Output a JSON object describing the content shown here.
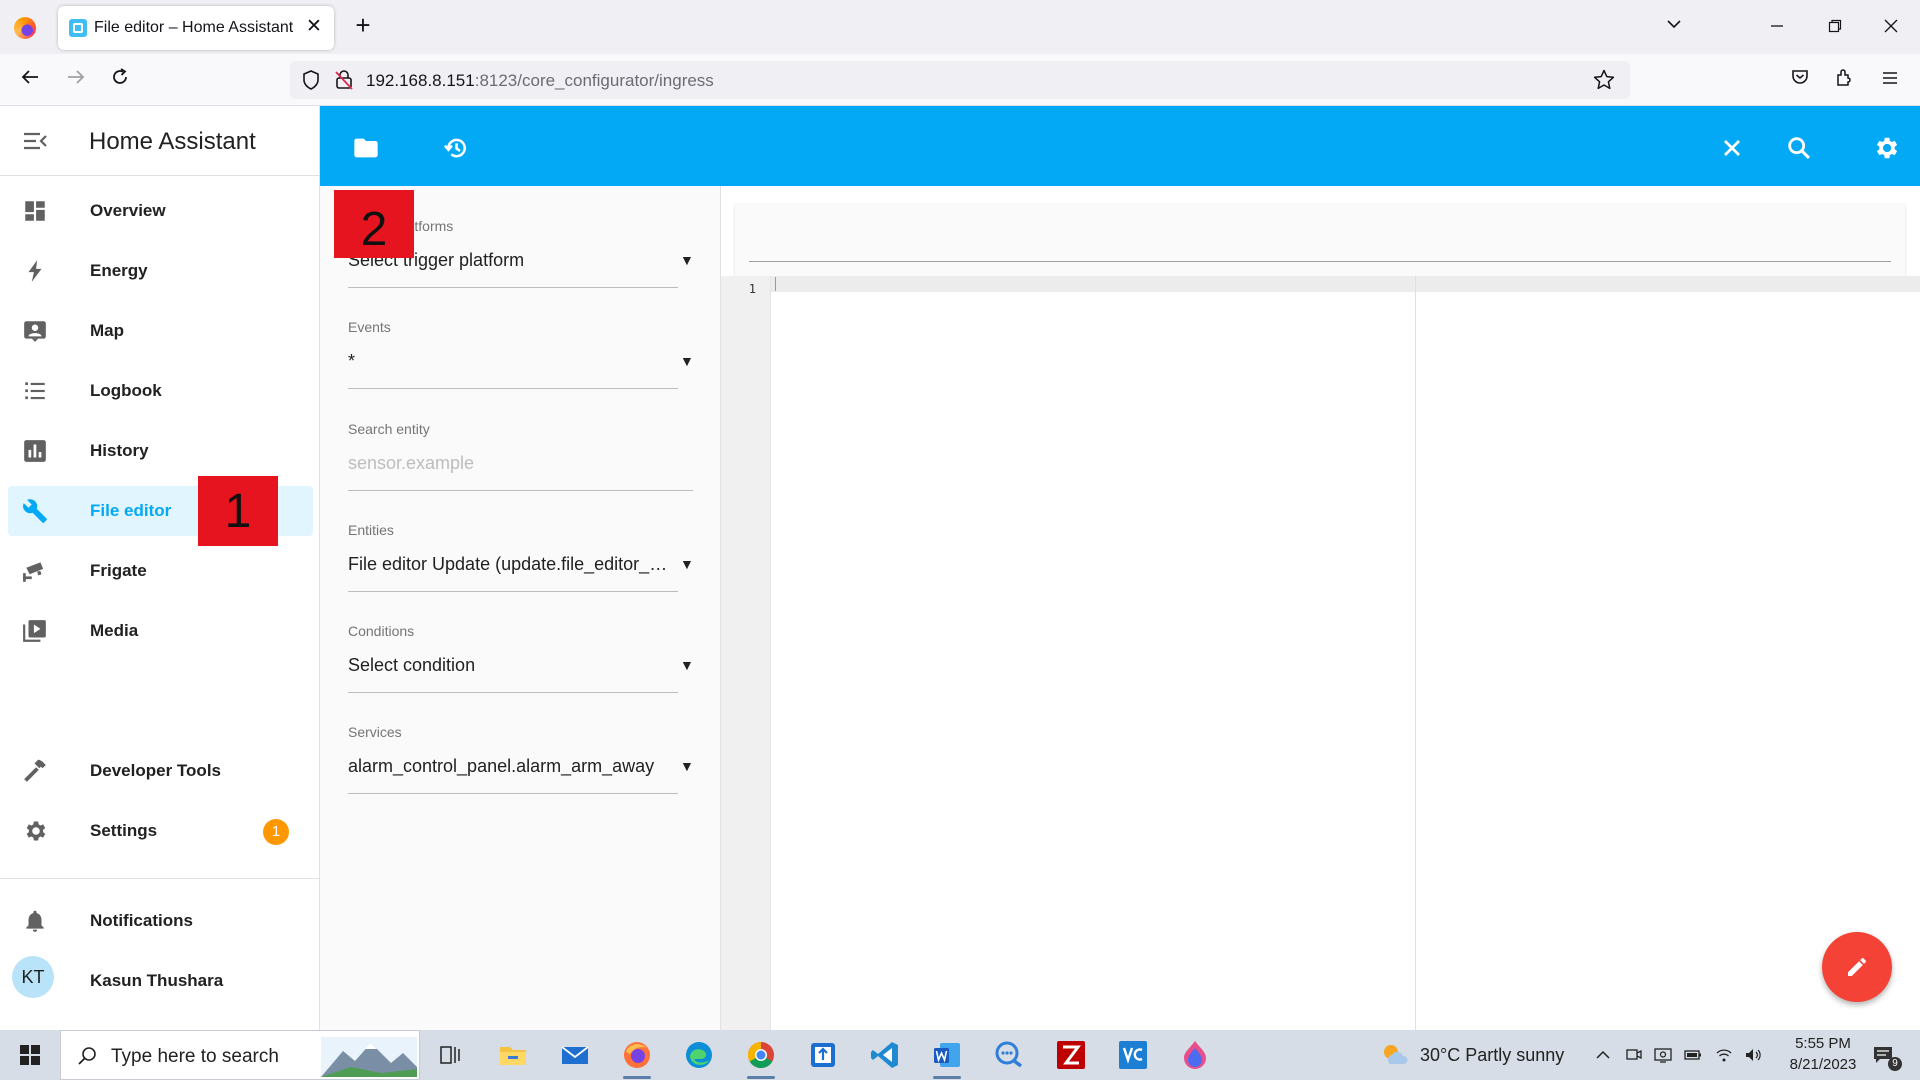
{
  "browser": {
    "tab_title": "File editor – Home Assistant",
    "tab_close": "✕",
    "new_tab": "+",
    "url_host": "192.168.8.151",
    "url_rest": ":8123/core_configurator/ingress"
  },
  "sidebar": {
    "title": "Home Assistant",
    "items": [
      {
        "label": "Overview"
      },
      {
        "label": "Energy"
      },
      {
        "label": "Map"
      },
      {
        "label": "Logbook"
      },
      {
        "label": "History"
      },
      {
        "label": "File editor"
      },
      {
        "label": "Frigate"
      },
      {
        "label": "Media"
      }
    ],
    "developer_tools": "Developer Tools",
    "settings": "Settings",
    "settings_badge": "1",
    "notifications": "Notifications",
    "user_initials": "KT",
    "user_name": "Kasun Thushara",
    "accent_color": "#03a9f4"
  },
  "form": {
    "trigger": {
      "label": "Trigger platforms",
      "value": "Select trigger platform"
    },
    "events": {
      "label": "Events",
      "value": "*"
    },
    "search_entity": {
      "label": "Search entity",
      "placeholder": "sensor.example"
    },
    "entities": {
      "label": "Entities",
      "value": "File editor Update (update.file_editor_update)"
    },
    "conditions": {
      "label": "Conditions",
      "value": "Select condition"
    },
    "services": {
      "label": "Services",
      "value": "alarm_control_panel.alarm_arm_away"
    },
    "dropdown_arrow": "▼"
  },
  "editor": {
    "line_number": "1"
  },
  "markers": {
    "m1": "1",
    "m2": "2"
  },
  "taskbar": {
    "search_placeholder": "Type here to search",
    "weather": "30°C  Partly sunny",
    "time": "5:55 PM",
    "date": "8/21/2023",
    "notification_count": "9"
  },
  "colors": {
    "app_bar": "#03a9f4",
    "fab": "#f44336",
    "badge": "#ff9800",
    "marker": "#e6141e"
  }
}
